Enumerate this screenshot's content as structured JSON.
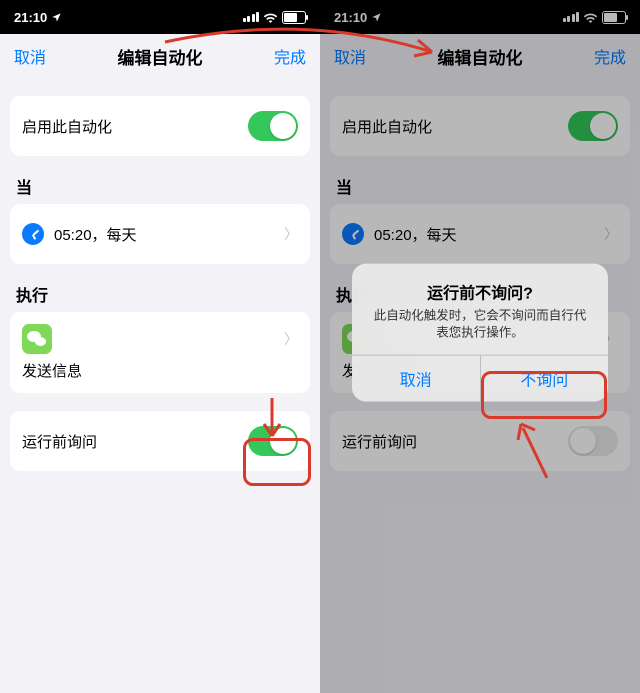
{
  "status": {
    "time": "21:10"
  },
  "nav": {
    "cancel": "取消",
    "title": "编辑自动化",
    "done": "完成"
  },
  "enable": {
    "label": "启用此自动化"
  },
  "when": {
    "heading": "当",
    "time_label": "05:20，每天"
  },
  "do": {
    "heading": "执行",
    "action_label": "发送信息"
  },
  "ask": {
    "label": "运行前询问"
  },
  "alert": {
    "title": "运行前不询问?",
    "message": "此自动化触发时，它会不询问而自行代表您执行操作。",
    "cancel": "取消",
    "confirm": "不询问"
  }
}
